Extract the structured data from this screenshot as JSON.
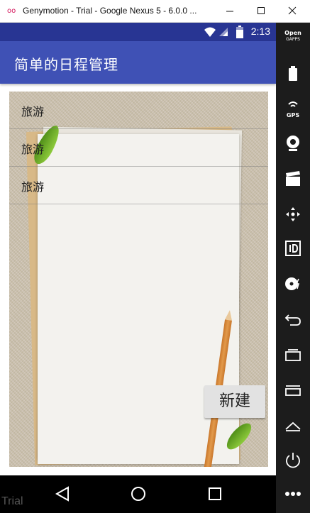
{
  "window": {
    "title": "Genymotion - Trial - Google Nexus 5 - 6.0.0 ...",
    "app_icon_glyph": "oo"
  },
  "statusbar": {
    "time": "2:13",
    "background": "#283593"
  },
  "appbar": {
    "title": "简单的日程管理",
    "background": "#3f51b5"
  },
  "schedule_list": {
    "items": [
      {
        "label": "旅游"
      },
      {
        "label": "旅游"
      },
      {
        "label": "旅游"
      }
    ]
  },
  "actions": {
    "new_label": "新建"
  },
  "navbar": {
    "watermark": "Trial"
  },
  "sidebar": {
    "opengapps_line1": "Open",
    "opengapps_line2": "GAPPS",
    "gps_label": "GPS",
    "items": [
      "battery-icon",
      "gps-icon",
      "webcam-icon",
      "capture-icon",
      "dpad-icon",
      "identifiers-icon",
      "media-icon",
      "back-icon",
      "recent-apps-icon",
      "menu-icon",
      "home-icon",
      "power-icon",
      "more-icon"
    ]
  }
}
